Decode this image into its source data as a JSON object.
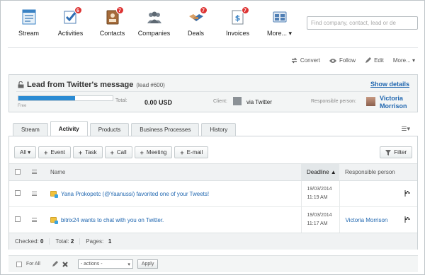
{
  "nav": {
    "items": [
      {
        "label": "Stream",
        "icon": "stream-icon",
        "badge": ""
      },
      {
        "label": "Activities",
        "icon": "activities-icon",
        "badge": "6"
      },
      {
        "label": "Contacts",
        "icon": "contacts-icon",
        "badge": "7"
      },
      {
        "label": "Companies",
        "icon": "companies-icon",
        "badge": ""
      },
      {
        "label": "Deals",
        "icon": "deals-icon",
        "badge": "7"
      },
      {
        "label": "Invoices",
        "icon": "invoices-icon",
        "badge": "7"
      },
      {
        "label": "More... ▾",
        "icon": "more-icon",
        "badge": ""
      }
    ],
    "search_placeholder": "Find company, contact, lead or de"
  },
  "actions": {
    "convert": "Convert",
    "follow": "Follow",
    "edit": "Edit",
    "more": "More... ▾"
  },
  "lead": {
    "title": "Lead from Twitter's message",
    "number": "(lead #600)",
    "show_details": "Show details",
    "progress_fraction": 0.6,
    "progress_label": "Free",
    "total_label": "Total:",
    "total_value": "0.00 USD",
    "client_label": "Client:",
    "client_value": "via Twitter",
    "responsible_label": "Responsible person:",
    "responsible_line1": "Victoria",
    "responsible_line2": "Morrison"
  },
  "tabs": [
    "Stream",
    "Activity",
    "Products",
    "Business Processes",
    "History"
  ],
  "tab_menu": "☰▾",
  "toolbar": {
    "all": "All ▾",
    "event": "Event",
    "task": "Task",
    "call": "Call",
    "meeting": "Meeting",
    "email": "E-mail",
    "filter": "Filter"
  },
  "table": {
    "col_name": "Name",
    "col_deadline": "Deadline ▲",
    "col_responsible": "Responsible person",
    "rows": [
      {
        "name": "Yana Prokopetc (@Yaanussi) favorited one of your Tweets!",
        "date": "19/03/2014",
        "time": "11:19 AM",
        "responsible": ""
      },
      {
        "name": "bitrix24 wants to chat with you on Twitter.",
        "date": "19/03/2014",
        "time": "11:17 AM",
        "responsible": "Victoria Morrison"
      }
    ]
  },
  "footer": {
    "checked_label": "Checked:",
    "checked": "0",
    "total_label": "Total:",
    "total": "2",
    "pages_label": "Pages:",
    "pages": "1"
  },
  "bottom": {
    "for_all": "For All",
    "actions_select": "- actions -",
    "apply": "Apply"
  }
}
